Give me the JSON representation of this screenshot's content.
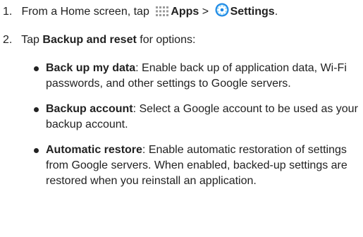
{
  "steps": [
    {
      "number": "1.",
      "prefix": "From a Home screen, tap",
      "apps_label": "Apps",
      "separator": ">",
      "settings_label": "Settings",
      "suffix": "."
    },
    {
      "number": "2.",
      "prefix": "Tap",
      "bold": "Backup and reset",
      "suffix": "for options:"
    }
  ],
  "options": [
    {
      "title": "Back up my data",
      "description": ": Enable back up of application data, Wi-Fi passwords, and other settings to Google servers."
    },
    {
      "title": "Backup account",
      "description": ": Select a Google account to be used as your backup account."
    },
    {
      "title": "Automatic restore",
      "description": ": Enable automatic restoration of settings from Google servers. When enabled, backed-up settings are restored when you reinstall an application."
    }
  ],
  "icons": {
    "apps": "apps-grid-icon",
    "settings": "settings-gear-icon"
  },
  "colors": {
    "text": "#222222",
    "settings_icon": "#1e88e5"
  }
}
